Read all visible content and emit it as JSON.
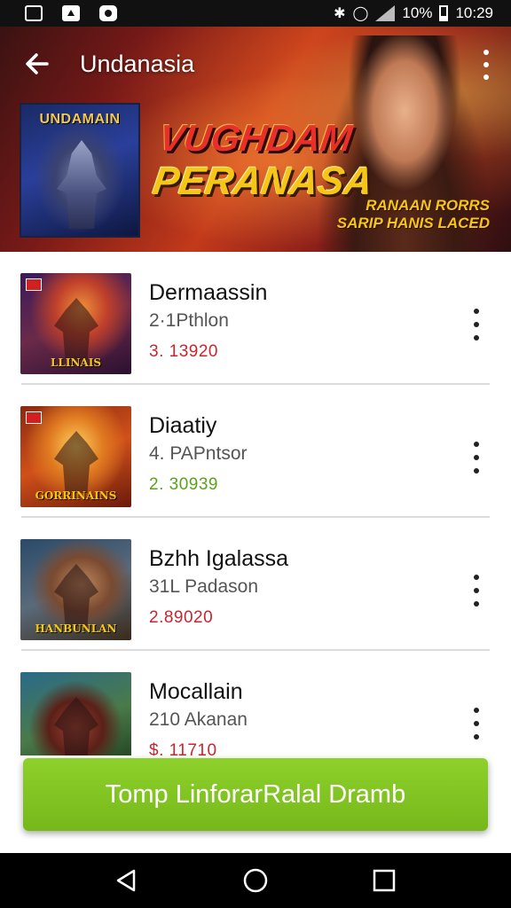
{
  "status_bar": {
    "battery": "10%",
    "time": "10:29"
  },
  "header": {
    "title": "Undanasia",
    "cover_label": "UNDAMAIN",
    "banner_title_line1": "VUGHDAM",
    "banner_title_line2": "PERANASA",
    "banner_sub_line1": "RANAAN RORRS",
    "banner_sub_line2": "SARIP HANIS LACED"
  },
  "items": [
    {
      "name": "Dermaassin",
      "subtitle": "2·1Pthlon",
      "price": "3. 13920",
      "price_color": "#c8262e",
      "thumb_caption": "LLINAIS"
    },
    {
      "name": "Diaatiy",
      "subtitle": "4. PAPntsor",
      "price": "2. 30939",
      "price_color": "#5aa21a",
      "thumb_caption": "GORRINAINS"
    },
    {
      "name": "Bzhh Igalassa",
      "subtitle": "31L Padason",
      "price": "2.89020",
      "price_color": "#c8262e",
      "thumb_caption": "HANBUNLAN"
    },
    {
      "name": "Mocallain",
      "subtitle": "210 Akanan",
      "price": "$. 11710",
      "price_color": "#c8262e",
      "thumb_caption": ""
    }
  ],
  "cta": {
    "label": "Tomp LinforarRalal Dramb"
  },
  "colors": {
    "cta": "#7ec11f",
    "price_red": "#c8262e",
    "price_green": "#5aa21a"
  }
}
